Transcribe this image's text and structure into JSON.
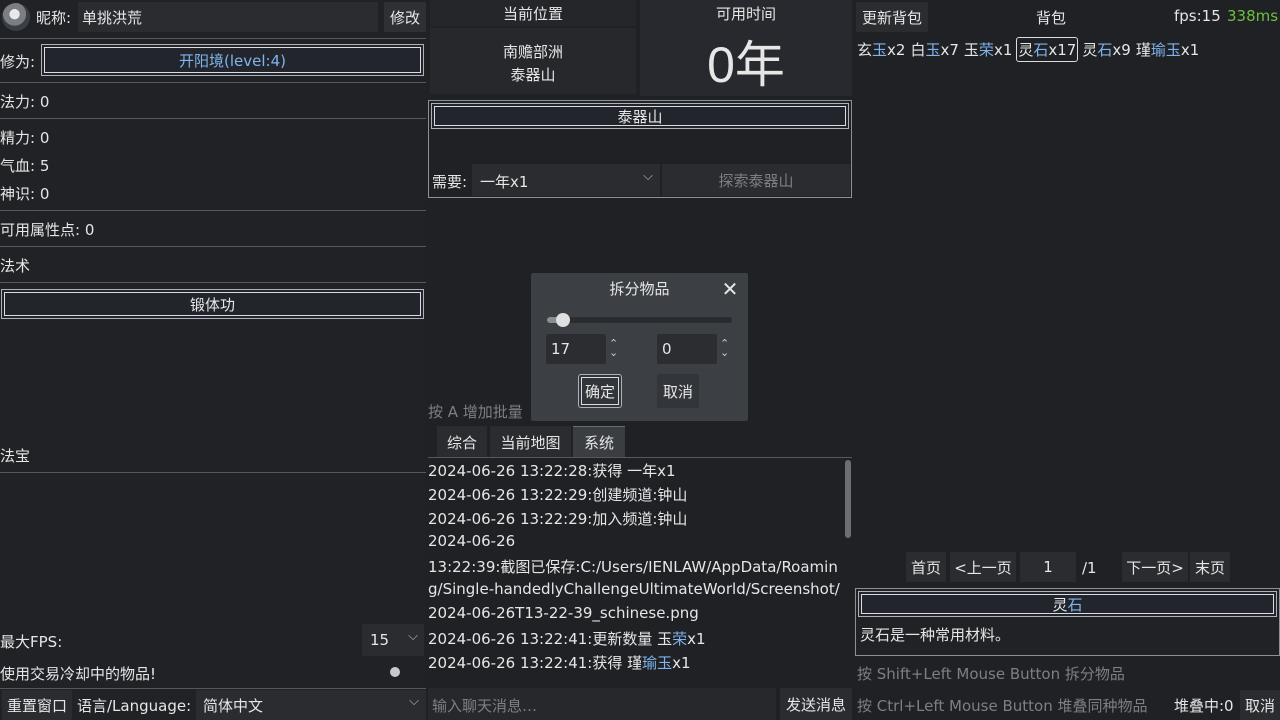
{
  "profile": {
    "nickname_label": "昵称:",
    "nickname": "单挑洪荒",
    "edit_label": "修改"
  },
  "cultivation": {
    "label": "修为:",
    "value": "开阳境(level:4)"
  },
  "stats": {
    "mana": "法力: 0",
    "energy": "精力: 0",
    "blood": "气血: 5",
    "spirit": "神识: 0",
    "points": "可用属性点: 0"
  },
  "spells": {
    "header": "法术",
    "items": [
      "锻体功"
    ]
  },
  "treasures": {
    "header": "法宝"
  },
  "settings": {
    "max_fps_label": "最大FPS:",
    "max_fps_value": "15",
    "use_cooldown_label": "使用交易冷却中的物品!",
    "reset_window": "重置窗口",
    "language_label": "语言/Language:",
    "language_value": "简体中文"
  },
  "location": {
    "header": "当前位置",
    "region": "南赡部洲",
    "place": "泰器山"
  },
  "time": {
    "header": "可用时间",
    "value": "0年"
  },
  "explore": {
    "title": "泰器山",
    "need_label": "需要:",
    "need_value": "一年x1",
    "explore_button": "探索泰器山"
  },
  "hint_batch": "按 A 增加批量",
  "split_dialog": {
    "title": "拆分物品",
    "slider_fraction": 0.05,
    "left_value": "17",
    "right_value": "0",
    "confirm": "确定",
    "cancel": "取消"
  },
  "chat": {
    "tabs": [
      "综合",
      "当前地图",
      "系统"
    ],
    "active_tab": 2,
    "lines": [
      {
        "parts": [
          [
            "2024-06-26 13:22:28:获得 一年x1",
            ""
          ]
        ]
      },
      {
        "parts": [
          [
            "2024-06-26 13:22:29:创建频道:钟山",
            ""
          ]
        ]
      },
      {
        "parts": [
          [
            "2024-06-26 13:22:29:加入频道:钟山",
            ""
          ]
        ]
      },
      {
        "parts": [
          [
            "2024-06-26",
            ""
          ]
        ]
      },
      {
        "parts": [
          [
            "13:22:39:截图已保存:C:/Users/IENLAW/AppData/Roamin",
            ""
          ]
        ]
      },
      {
        "parts": [
          [
            "g/Single-handedlyChallengeUltimateWorld/Screenshot/",
            ""
          ]
        ]
      },
      {
        "parts": [
          [
            "2024-06-26T13-22-39_schinese.png",
            ""
          ]
        ]
      },
      {
        "parts": [
          [
            "2024-06-26 13:22:41:更新数量 玉",
            ""
          ],
          [
            "荣",
            "#7fb4ec"
          ],
          [
            "x1",
            ""
          ]
        ]
      },
      {
        "parts": [
          [
            "2024-06-26 13:22:41:获得 瑾",
            ""
          ],
          [
            "瑜玉",
            "#7fb4ec"
          ],
          [
            "x1",
            ""
          ]
        ]
      }
    ],
    "input_placeholder": "输入聊天消息…",
    "send_button": "发送消息"
  },
  "bag": {
    "refresh_button": "更新背包",
    "header": "背包",
    "fps_label": "fps:15",
    "ping_label": "338ms",
    "ping_color": "#6fbf3f",
    "items": [
      {
        "parts": [
          [
            "玄",
            ""
          ],
          [
            "玉",
            "#7fb4ec"
          ],
          [
            "x2",
            ""
          ]
        ]
      },
      {
        "parts": [
          [
            "白",
            ""
          ],
          [
            "玉",
            "#7fb4ec"
          ],
          [
            "x7",
            ""
          ]
        ]
      },
      {
        "parts": [
          [
            "玉",
            ""
          ],
          [
            "荣",
            "#7fb4ec"
          ],
          [
            "x1",
            ""
          ]
        ]
      },
      {
        "parts": [
          [
            "灵",
            ""
          ],
          [
            "石",
            "#7fb4ec"
          ],
          [
            "x17",
            ""
          ]
        ],
        "selected": true
      },
      {
        "parts": [
          [
            "灵",
            ""
          ],
          [
            "石",
            "#7fb4ec"
          ],
          [
            "x9",
            ""
          ]
        ]
      },
      {
        "parts": [
          [
            "瑾",
            ""
          ],
          [
            "瑜玉",
            "#7fb4ec"
          ],
          [
            "x1",
            ""
          ]
        ]
      }
    ],
    "pager": {
      "first": "首页",
      "prev": "<上一页",
      "page": "1",
      "total": "/1",
      "next": "下一页>",
      "last": "末页"
    },
    "detail_title_a": "灵",
    "detail_title_b": "石",
    "detail_desc": "灵石是一种常用材料。",
    "hint_split": "按 Shift+Left Mouse Button 拆分物品",
    "hint_stack": "按 Ctrl+Left Mouse Button 堆叠同种物品",
    "stacking_label": "堆叠中:0",
    "cancel_button": "取消"
  }
}
